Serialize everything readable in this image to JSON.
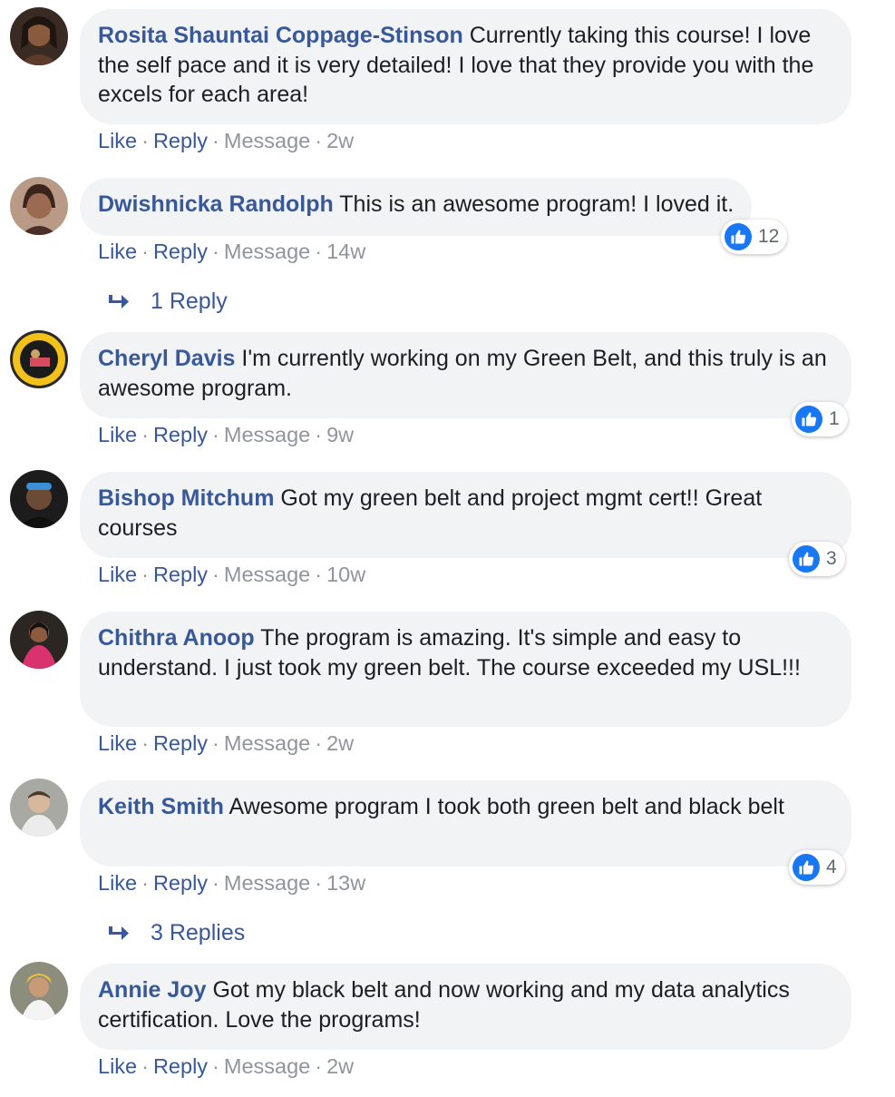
{
  "actions": {
    "like": "Like",
    "reply": "Reply",
    "message": "Message",
    "sep": "·"
  },
  "colors": {
    "author": "#385898",
    "bubble": "#f2f3f5",
    "like_blue": "#1877f2",
    "meta": "#90949c"
  },
  "comments": [
    {
      "author": "Rosita Shauntai Coppage-Stinson",
      "text": "Currently taking this course! I love the self pace and it is very detailed! I love that they provide you with the excels for each area!",
      "time": "2w"
    },
    {
      "author": "Dwishnicka Randolph",
      "text": "This is an awesome program! I loved it.",
      "time": "14w",
      "reactions": "12",
      "replies": "1 Reply"
    },
    {
      "author": "Cheryl Davis",
      "text": "I'm currently working on my Green Belt, and this truly is an awesome program.",
      "time": "9w",
      "reactions": "1"
    },
    {
      "author": "Bishop Mitchum",
      "text": "Got my green belt and project mgmt cert!! Great courses",
      "time": "10w",
      "reactions": "3"
    },
    {
      "author": "Chithra Anoop",
      "text": "The program is amazing. It's simple and easy to understand. I just took my green belt. The course exceeded my USL!!!",
      "time": "2w"
    },
    {
      "author": "Keith Smith",
      "text": "Awesome program I took both green belt and black belt",
      "time": "13w",
      "reactions": "4",
      "replies": "3 Replies"
    },
    {
      "author": "Annie Joy",
      "text": "Got my black belt and now working and my data analytics certification. Love the programs!",
      "time": "2w"
    }
  ]
}
